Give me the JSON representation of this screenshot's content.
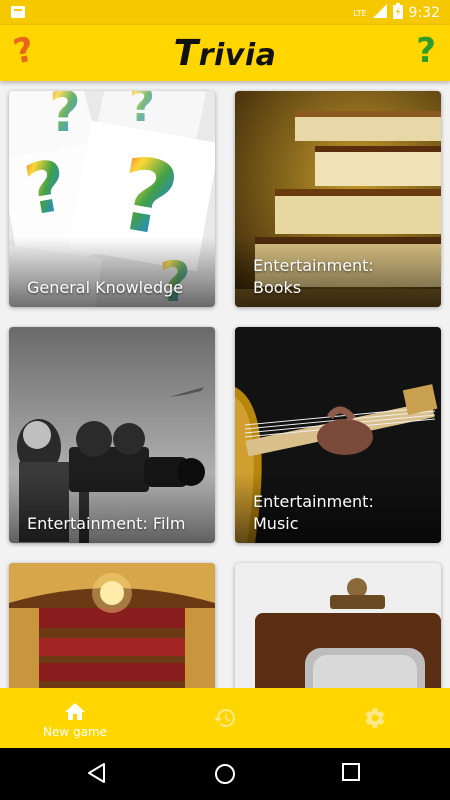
{
  "status_bar": {
    "time": "9:32",
    "network": "LTE"
  },
  "app_bar": {
    "title_first": "T",
    "title_rest": "rivia",
    "left_icon": "question-mark-orange-icon",
    "right_icon": "question-mark-green-icon"
  },
  "categories": [
    {
      "label": "General Knowledge"
    },
    {
      "label": "Entertainment:\nBooks"
    },
    {
      "label": "Entertainment: Film"
    },
    {
      "label": "Entertainment:\nMusic"
    },
    {
      "label": ""
    },
    {
      "label": ""
    }
  ],
  "bottom_nav": {
    "items": [
      {
        "label": "New game",
        "icon": "home-icon",
        "active": true
      },
      {
        "label": "",
        "icon": "history-icon",
        "active": false
      },
      {
        "label": "",
        "icon": "gear-icon",
        "active": false
      }
    ]
  },
  "system_nav": {
    "icons": [
      "back-icon",
      "home-circle-icon",
      "recents-icon"
    ]
  },
  "colors": {
    "primary": "#ffd600",
    "status": "#f5c800",
    "accent_orange": "#e8671c",
    "accent_green": "#2e9d2b"
  }
}
